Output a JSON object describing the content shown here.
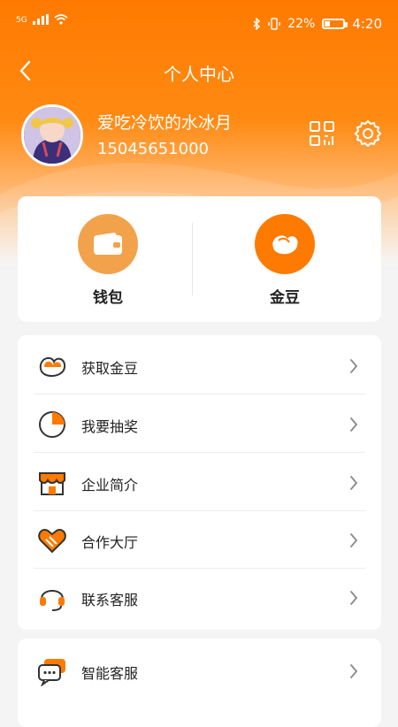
{
  "status_bar": {
    "network": "5G",
    "battery": "22%",
    "time": "4:20"
  },
  "nav": {
    "title": "个人中心"
  },
  "profile": {
    "username": "爱吃冷饮的水冰月",
    "phone": "15045651000"
  },
  "wallet_section": {
    "items": [
      {
        "label": "钱包",
        "icon": "wallet-icon",
        "color": "#f2a24a"
      },
      {
        "label": "金豆",
        "icon": "bean-icon",
        "color": "#ff7a00"
      }
    ]
  },
  "menu": {
    "items": [
      {
        "label": "获取金豆",
        "icon": "bean-icon"
      },
      {
        "label": "我要抽奖",
        "icon": "lottery-icon"
      },
      {
        "label": "企业简介",
        "icon": "store-icon"
      },
      {
        "label": "合作大厅",
        "icon": "handshake-heart-icon"
      },
      {
        "label": "联系客服",
        "icon": "headset-icon"
      }
    ]
  },
  "menu2": {
    "items": [
      {
        "label": "智能客服",
        "icon": "chat-bubble-icon"
      }
    ]
  },
  "colors": {
    "accent": "#ff7a00",
    "accent_light": "#f2a24a",
    "text": "#222222",
    "background": "#f4f4f4"
  }
}
